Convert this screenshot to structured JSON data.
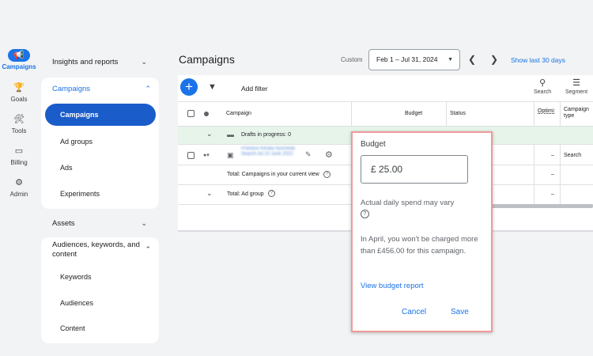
{
  "rail": [
    {
      "label": "Campaigns",
      "icon": "megaphone-icon",
      "glyph": "📢"
    },
    {
      "label": "Goals",
      "icon": "trophy-icon",
      "glyph": "🏆"
    },
    {
      "label": "Tools",
      "icon": "tools-icon",
      "glyph": "🛠"
    },
    {
      "label": "Billing",
      "icon": "credit-card-icon",
      "glyph": "▭"
    },
    {
      "label": "Admin",
      "icon": "gear-icon",
      "glyph": "⚙"
    }
  ],
  "nav": {
    "insights": "Insights and reports",
    "campaigns_group": "Campaigns",
    "campaigns": "Campaigns",
    "ad_groups": "Ad groups",
    "ads": "Ads",
    "experiments": "Experiments",
    "assets": "Assets",
    "audiences_group": "Audiences, keywords, and content",
    "keywords": "Keywords",
    "audiences": "Audiences",
    "content": "Content"
  },
  "header": {
    "title": "Campaigns",
    "custom": "Custom",
    "date_range": "Feb 1 – Jul 31, 2024",
    "show_last": "Show last 30 days"
  },
  "toolbar": {
    "add_filter": "Add filter",
    "search": "Search",
    "segment": "Segment"
  },
  "table": {
    "col_campaign": "Campaign",
    "col_budget": "Budget",
    "col_status": "Status",
    "col_optimization": "Optimi:",
    "col_campaign_type": "Campaign type",
    "drafts": "Drafts in progress: 0",
    "row_name": "Pranava Kerala Ayurveda Search Ad 10 June 2022",
    "row_dash": "–",
    "row_type": "Search",
    "total_campaigns": "Total: Campaigns in your current view",
    "total_adgroup": "Total: Ad group",
    "dash": "–"
  },
  "popup": {
    "title": "Budget",
    "value": "£ 25.00",
    "note": "Actual daily spend may vary",
    "charge_text": "In April, you won't be charged more than £456.00 for this campaign.",
    "report_link": "View budget report",
    "cancel": "Cancel",
    "save": "Save"
  },
  "colors": {
    "accent": "#1a73e8",
    "draft_row": "#e6f4ea",
    "popup_border": "#ef9a9a"
  }
}
